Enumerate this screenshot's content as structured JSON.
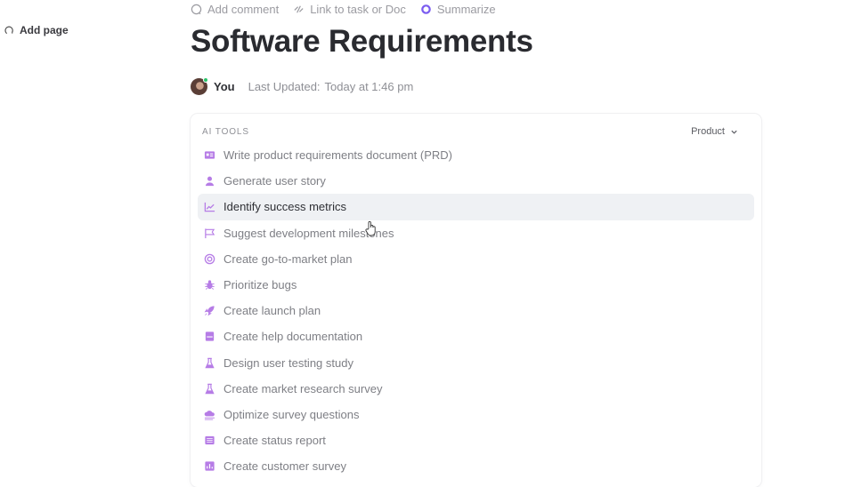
{
  "sidebar": {
    "add_page": "Add page"
  },
  "toolbar": {
    "add_comment": "Add comment",
    "link_task": "Link to task or Doc",
    "summarize": "Summarize"
  },
  "page": {
    "title": "Software Requirements"
  },
  "meta": {
    "author": "You",
    "last_updated_label": "Last Updated:",
    "last_updated_value": "Today at 1:46 pm"
  },
  "ai_tools": {
    "section_label": "AI TOOLS",
    "category_selected": "Product",
    "accent_color": "#b67ce6",
    "items": [
      {
        "label": "Write product requirements document (PRD)",
        "icon": "id-card-icon"
      },
      {
        "label": "Generate user story",
        "icon": "user-icon"
      },
      {
        "label": "Identify success metrics",
        "icon": "chart-line-icon",
        "active": true
      },
      {
        "label": "Suggest development milestones",
        "icon": "flag-icon"
      },
      {
        "label": "Create go-to-market plan",
        "icon": "target-icon"
      },
      {
        "label": "Prioritize bugs",
        "icon": "bug-icon"
      },
      {
        "label": "Create launch plan",
        "icon": "rocket-icon"
      },
      {
        "label": "Create help documentation",
        "icon": "book-icon"
      },
      {
        "label": "Design user testing study",
        "icon": "flask-icon"
      },
      {
        "label": "Create market research survey",
        "icon": "flask-icon"
      },
      {
        "label": "Optimize survey questions",
        "icon": "cloud-icon"
      },
      {
        "label": "Create status report",
        "icon": "list-icon"
      },
      {
        "label": "Create customer survey",
        "icon": "survey-icon"
      }
    ]
  }
}
